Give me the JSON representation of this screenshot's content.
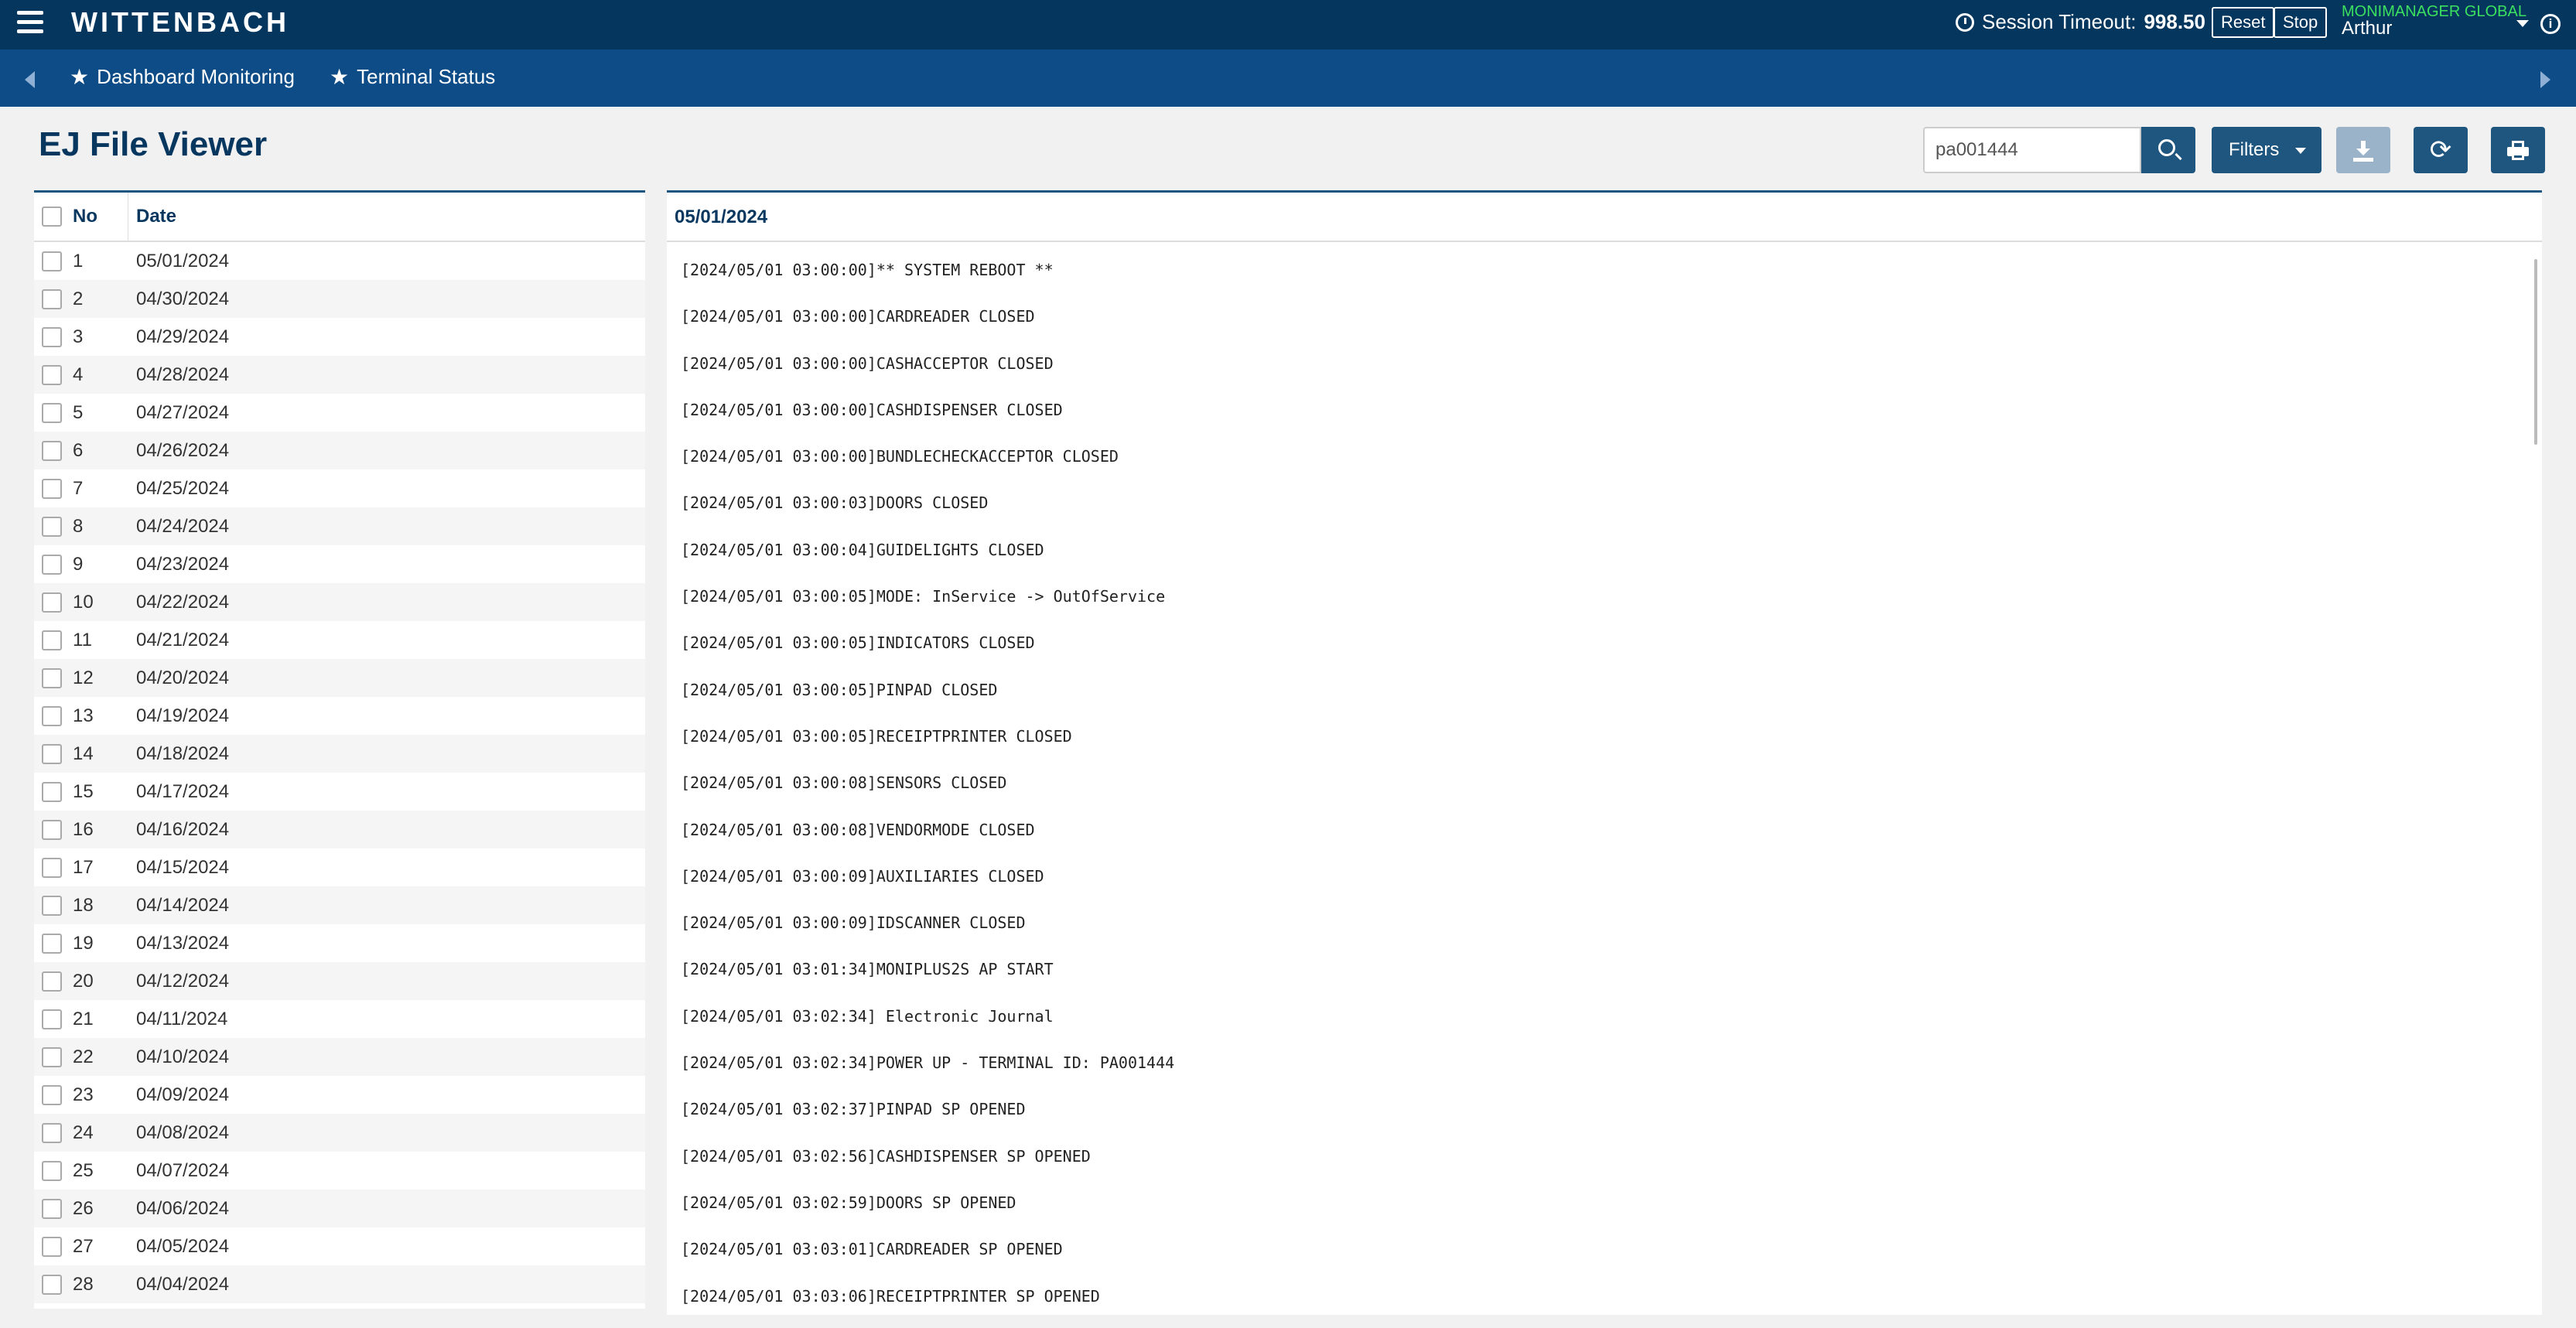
{
  "app": {
    "logo": "WITTENBACH"
  },
  "header": {
    "session_label": "Session Timeout:",
    "session_value": "998.50",
    "reset_label": "Reset",
    "stop_label": "Stop",
    "org": "MONIMANAGER GLOBAL",
    "user": "Arthur"
  },
  "nav": {
    "items": [
      {
        "label": "Dashboard Monitoring"
      },
      {
        "label": "Terminal Status"
      }
    ]
  },
  "page": {
    "title": "EJ File Viewer"
  },
  "toolbar": {
    "search_value": "pa001444",
    "filters_label": "Filters",
    "refresh_glyph": "⟳"
  },
  "list": {
    "columns": {
      "no": "No",
      "date": "Date"
    },
    "rows": [
      {
        "no": "1",
        "date": "05/01/2024"
      },
      {
        "no": "2",
        "date": "04/30/2024"
      },
      {
        "no": "3",
        "date": "04/29/2024"
      },
      {
        "no": "4",
        "date": "04/28/2024"
      },
      {
        "no": "5",
        "date": "04/27/2024"
      },
      {
        "no": "6",
        "date": "04/26/2024"
      },
      {
        "no": "7",
        "date": "04/25/2024"
      },
      {
        "no": "8",
        "date": "04/24/2024"
      },
      {
        "no": "9",
        "date": "04/23/2024"
      },
      {
        "no": "10",
        "date": "04/22/2024"
      },
      {
        "no": "11",
        "date": "04/21/2024"
      },
      {
        "no": "12",
        "date": "04/20/2024"
      },
      {
        "no": "13",
        "date": "04/19/2024"
      },
      {
        "no": "14",
        "date": "04/18/2024"
      },
      {
        "no": "15",
        "date": "04/17/2024"
      },
      {
        "no": "16",
        "date": "04/16/2024"
      },
      {
        "no": "17",
        "date": "04/15/2024"
      },
      {
        "no": "18",
        "date": "04/14/2024"
      },
      {
        "no": "19",
        "date": "04/13/2024"
      },
      {
        "no": "20",
        "date": "04/12/2024"
      },
      {
        "no": "21",
        "date": "04/11/2024"
      },
      {
        "no": "22",
        "date": "04/10/2024"
      },
      {
        "no": "23",
        "date": "04/09/2024"
      },
      {
        "no": "24",
        "date": "04/08/2024"
      },
      {
        "no": "25",
        "date": "04/07/2024"
      },
      {
        "no": "26",
        "date": "04/06/2024"
      },
      {
        "no": "27",
        "date": "04/05/2024"
      },
      {
        "no": "28",
        "date": "04/04/2024"
      }
    ]
  },
  "viewer": {
    "title": "05/01/2024",
    "lines": [
      "[2024/05/01 03:00:00]** SYSTEM REBOOT **",
      "[2024/05/01 03:00:00]CARDREADER CLOSED",
      "[2024/05/01 03:00:00]CASHACCEPTOR CLOSED",
      "[2024/05/01 03:00:00]CASHDISPENSER CLOSED",
      "[2024/05/01 03:00:00]BUNDLECHECKACCEPTOR CLOSED",
      "[2024/05/01 03:00:03]DOORS CLOSED",
      "[2024/05/01 03:00:04]GUIDELIGHTS CLOSED",
      "[2024/05/01 03:00:05]MODE: InService -> OutOfService",
      "[2024/05/01 03:00:05]INDICATORS CLOSED",
      "[2024/05/01 03:00:05]PINPAD CLOSED",
      "[2024/05/01 03:00:05]RECEIPTPRINTER CLOSED",
      "[2024/05/01 03:00:08]SENSORS CLOSED",
      "[2024/05/01 03:00:08]VENDORMODE CLOSED",
      "[2024/05/01 03:00:09]AUXILIARIES CLOSED",
      "[2024/05/01 03:00:09]IDSCANNER CLOSED",
      "[2024/05/01 03:01:34]MONIPLUS2S AP START",
      "[2024/05/01 03:02:34] Electronic Journal",
      "[2024/05/01 03:02:34]POWER UP - TERMINAL ID: PA001444",
      "[2024/05/01 03:02:37]PINPAD SP OPENED",
      "[2024/05/01 03:02:56]CASHDISPENSER SP OPENED",
      "[2024/05/01 03:02:59]DOORS SP OPENED",
      "[2024/05/01 03:03:01]CARDREADER SP OPENED",
      "[2024/05/01 03:03:06]RECEIPTPRINTER SP OPENED"
    ]
  }
}
